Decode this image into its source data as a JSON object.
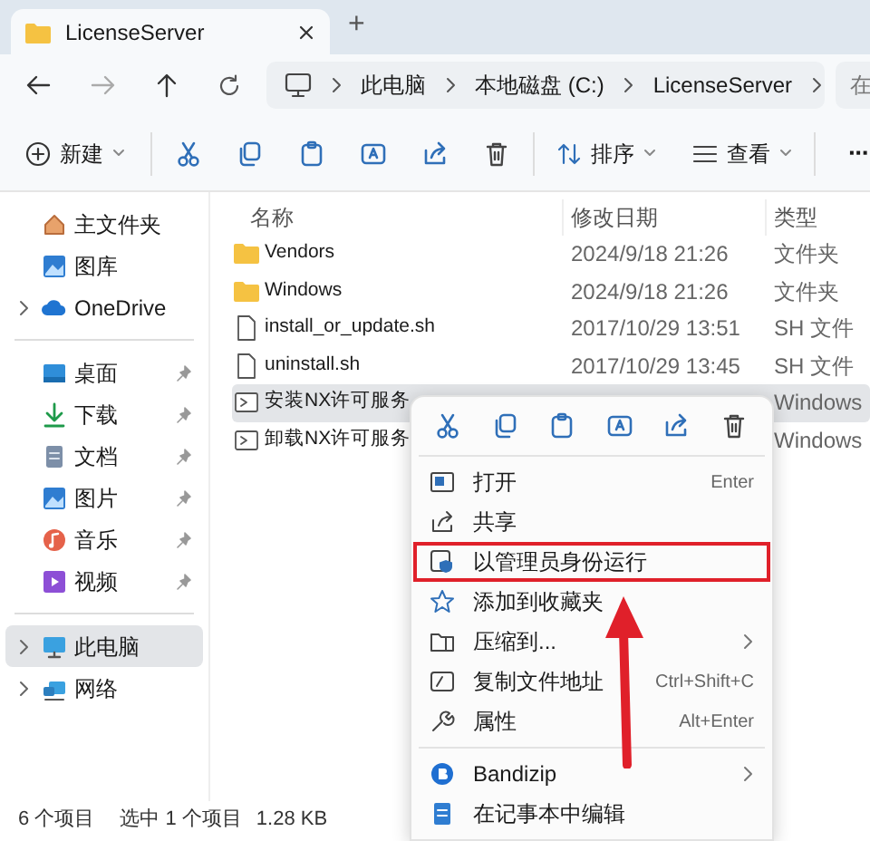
{
  "tabs": [
    {
      "title": "LicenseServer",
      "selected": true
    }
  ],
  "new_tab": "+",
  "breadcrumb": [
    "此电脑",
    "本地磁盘 (C:)",
    "LicenseServer"
  ],
  "search_text": "在",
  "toolbar": {
    "new": "新建",
    "sort": "排序",
    "view": "查看",
    "more": "···"
  },
  "sidebar": {
    "quick": [
      {
        "label": "主文件夹"
      },
      {
        "label": "图库"
      },
      {
        "label": "OneDrive",
        "expanded": false
      }
    ],
    "pinned": [
      {
        "label": "桌面",
        "pinned": true
      },
      {
        "label": "下载",
        "pinned": true
      },
      {
        "label": "文档",
        "pinned": true
      },
      {
        "label": "图片",
        "pinned": true
      },
      {
        "label": "音乐",
        "pinned": true
      },
      {
        "label": "视频",
        "pinned": true
      }
    ],
    "drives": [
      {
        "label": "此电脑",
        "selected": true,
        "expanded": false
      },
      {
        "label": "网络",
        "selected": false,
        "expanded": false
      }
    ]
  },
  "columns": [
    "名称",
    "修改日期",
    "类型"
  ],
  "rows": [
    {
      "name": "Vendors",
      "date": "2024/9/18 21:26",
      "type": "文件夹",
      "kind": "folder",
      "selected": false
    },
    {
      "name": "Windows",
      "date": "2024/9/18 21:26",
      "type": "文件夹",
      "kind": "folder",
      "selected": false
    },
    {
      "name": "install_or_update.sh",
      "date": "2017/10/29 13:51",
      "type": "SH 文件",
      "kind": "file",
      "selected": false
    },
    {
      "name": "uninstall.sh",
      "date": "2017/10/29 13:45",
      "type": "SH 文件",
      "kind": "file",
      "selected": false
    },
    {
      "name": "安装NX许可服务",
      "type": "Windows",
      "kind": "script",
      "selected": true
    },
    {
      "name": "卸载NX许可服务",
      "type": "Windows",
      "kind": "script",
      "selected": false
    }
  ],
  "status": {
    "count": "6 个项目",
    "selection": "选中 1 个项目",
    "size": "1.28 KB"
  },
  "context_menu": {
    "items": [
      {
        "label": "打开",
        "shortcut": "Enter",
        "highlighted": false,
        "submenu": false
      },
      {
        "label": "共享",
        "highlighted": false,
        "submenu": false
      },
      {
        "label": "以管理员身份运行",
        "highlighted": true,
        "submenu": false
      },
      {
        "label": "添加到收藏夹",
        "highlighted": false,
        "submenu": false
      },
      {
        "label": "压缩到...",
        "highlighted": false,
        "submenu": true
      },
      {
        "label": "复制文件地址",
        "shortcut": "Ctrl+Shift+C",
        "highlighted": false,
        "submenu": false
      },
      {
        "label": "属性",
        "shortcut": "Alt+Enter",
        "highlighted": false,
        "submenu": false
      }
    ],
    "extra_items": [
      {
        "label": "Bandizip",
        "submenu": true
      },
      {
        "label": "在记事本中编辑",
        "submenu": false
      }
    ]
  }
}
